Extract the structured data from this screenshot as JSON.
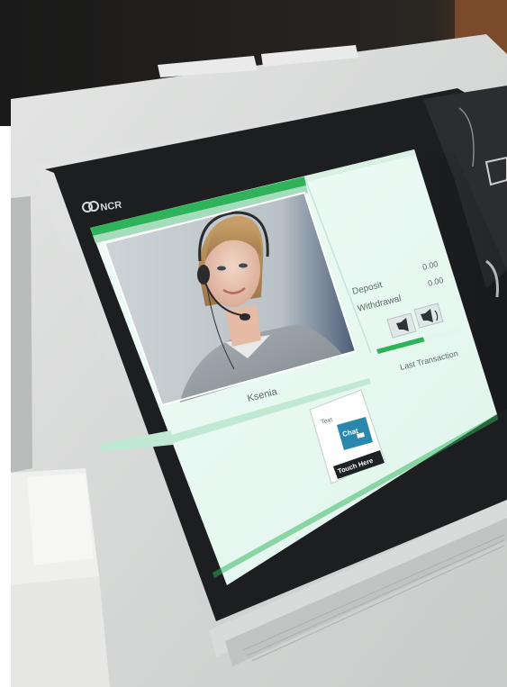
{
  "brand": {
    "logo_text": "NCR"
  },
  "agent": {
    "name": "Ksenia"
  },
  "panel": {
    "deposit_label": "Deposit",
    "deposit_value": "0.00",
    "withdrawal_label": "Withdrawal",
    "withdrawal_value": "0.00",
    "last_transaction_label": "Last Transaction"
  },
  "chat_widget": {
    "text_tab": "Text",
    "chat_tab": "Chat",
    "touch_label": "Touch Here"
  },
  "icons": {
    "volume_down": "speaker-low-icon",
    "volume_up": "speaker-high-icon"
  },
  "colors": {
    "accent_green": "#2fb35a",
    "screen_bg": "#eaf8f3",
    "chat_blue": "#2a87ad",
    "bezel": "#1c1e20"
  },
  "volume": {
    "level": 0.55
  }
}
